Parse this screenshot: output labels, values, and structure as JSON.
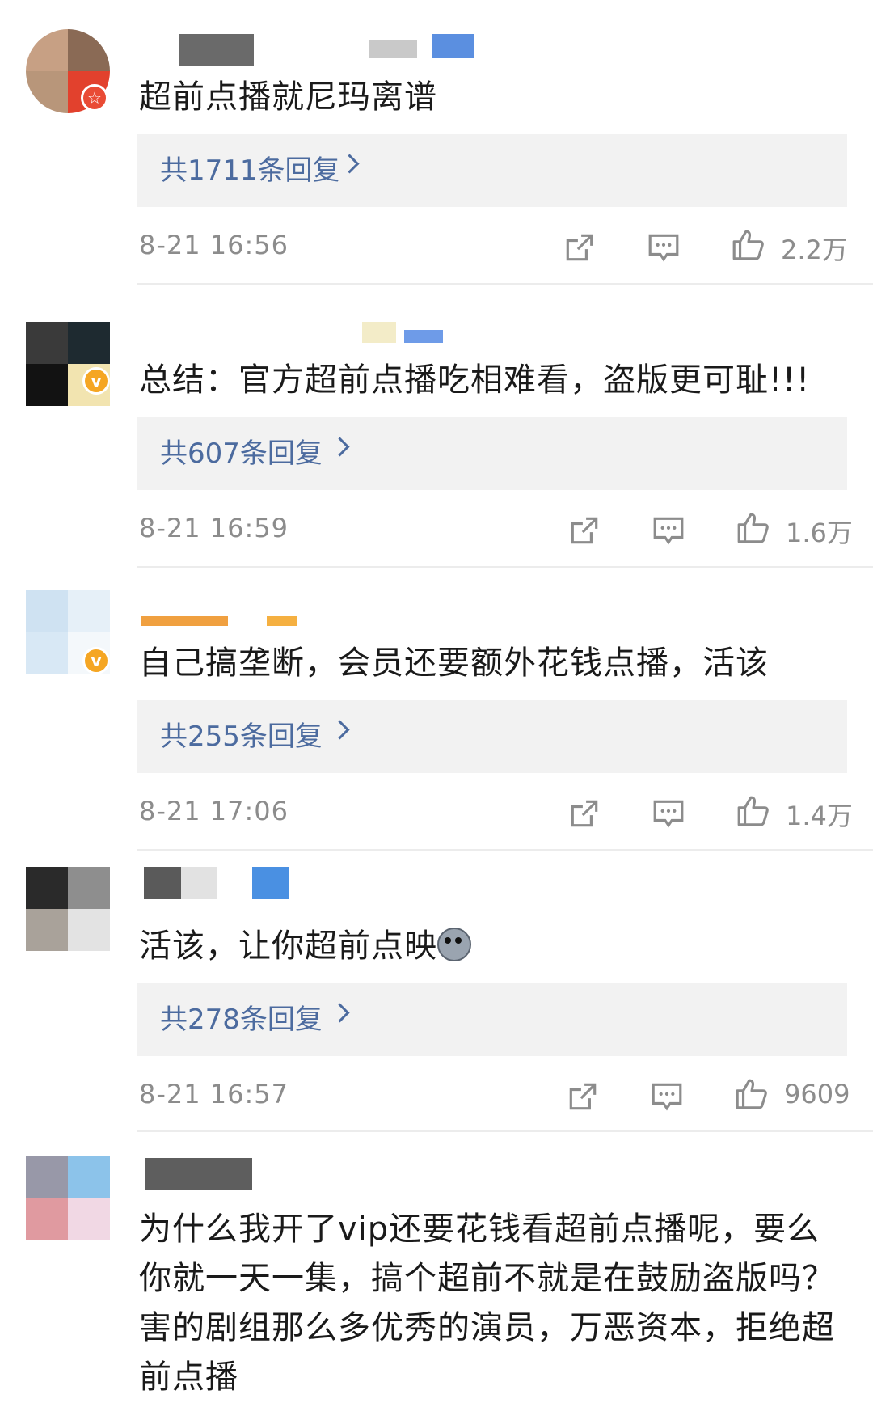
{
  "comments": [
    {
      "text": "超前点播就尼玛离谱",
      "replies": "共1711条回复",
      "time": "8-21 16:56",
      "likes": "2.2万",
      "badge": "star"
    },
    {
      "text": "总结：官方超前点播吃相难看，盗版更可耻!!!",
      "replies": "共607条回复",
      "time": "8-21 16:59",
      "likes": "1.6万",
      "badge": "verified"
    },
    {
      "text": "自己搞垄断，会员还要额外花钱点播，活该",
      "replies": "共255条回复",
      "time": "8-21 17:06",
      "likes": "1.4万",
      "badge": "verified"
    },
    {
      "text": "活该，让你超前点映",
      "replies": "共278条回复",
      "time": "8-21 16:57",
      "likes": "9609",
      "badge": "none"
    },
    {
      "text": "为什么我开了vip还要花钱看超前点播呢，要么你就一天一集，搞个超前不就是在鼓励盗版吗？害的剧组那么多优秀的演员，万恶资本，拒绝超前点播",
      "badge": "none"
    }
  ],
  "colors": {
    "reply_link": "#4c6b9f",
    "meta_gray": "#8c8c8c",
    "verified_badge": "#f5a623",
    "star_badge": "#e94b35"
  },
  "icons": {
    "share": "share-icon",
    "comment": "comment-icon",
    "like": "like-icon",
    "chevron": "chevron-right-icon",
    "verified": "verified-badge-icon",
    "star": "star-badge-icon"
  }
}
